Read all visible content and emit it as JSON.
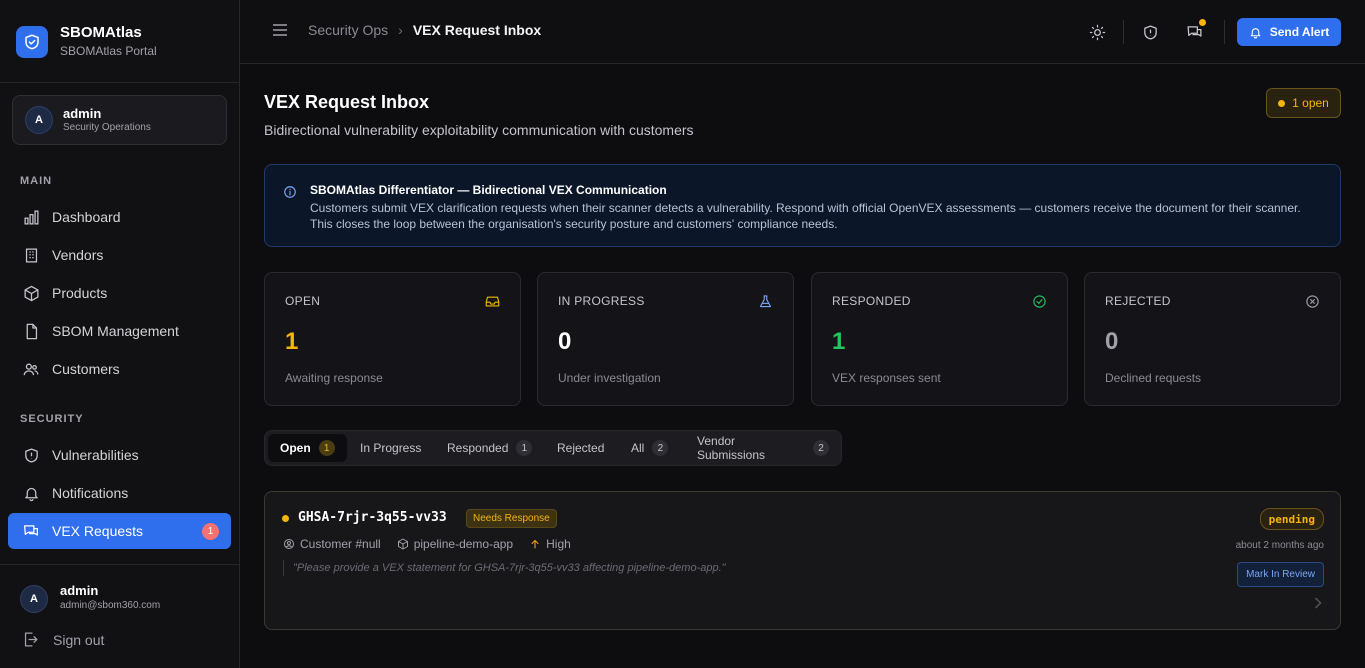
{
  "brand": {
    "title": "SBOMAtlas",
    "subtitle": "SBOMAtlas Portal"
  },
  "user_card": {
    "avatar": "A",
    "name": "admin",
    "role": "Security Operations"
  },
  "sidebar": {
    "main_label": "MAIN",
    "main_items": [
      {
        "label": "Dashboard",
        "icon": "chart-bars-icon"
      },
      {
        "label": "Vendors",
        "icon": "building-icon"
      },
      {
        "label": "Products",
        "icon": "cube-icon"
      },
      {
        "label": "SBOM Management",
        "icon": "document-icon"
      },
      {
        "label": "Customers",
        "icon": "users-icon"
      }
    ],
    "security_label": "SECURITY",
    "security_items": [
      {
        "label": "Vulnerabilities",
        "icon": "shield-alert-icon"
      },
      {
        "label": "Notifications",
        "icon": "bell-icon"
      },
      {
        "label": "VEX Requests",
        "icon": "chat-icon",
        "badge": "1",
        "active": true
      }
    ]
  },
  "bottom_user": {
    "avatar": "A",
    "name": "admin",
    "email": "admin@sbom360.com"
  },
  "signout": "Sign out",
  "header": {
    "breadcrumb_parent": "Security Ops",
    "breadcrumb_sep": "›",
    "breadcrumb_current": "VEX Request Inbox",
    "send_alert": "Send Alert"
  },
  "page": {
    "title": "VEX Request Inbox",
    "subtitle": "Bidirectional vulnerability exploitability communication with customers",
    "open_pill": "1 open"
  },
  "info": {
    "title": "SBOMAtlas Differentiator — Bidirectional VEX Communication",
    "body": "Customers submit VEX clarification requests when their scanner detects a vulnerability. Respond with official OpenVEX assessments — customers receive the document for their scanner. This closes the loop between the organisation's security posture and customers' compliance needs."
  },
  "stats": [
    {
      "label": "OPEN",
      "value": "1",
      "desc": "Awaiting response",
      "color": "#f5b50a",
      "icon": "inbox-icon"
    },
    {
      "label": "IN PROGRESS",
      "value": "0",
      "desc": "Under investigation",
      "color": "#ffffff",
      "icon": "flask-icon"
    },
    {
      "label": "RESPONDED",
      "value": "1",
      "desc": "VEX responses sent",
      "color": "#22c55e",
      "icon": "check-circle-icon"
    },
    {
      "label": "REJECTED",
      "value": "0",
      "desc": "Declined requests",
      "color": "#a1a1aa",
      "icon": "x-circle-icon"
    }
  ],
  "tabs": [
    {
      "label": "Open",
      "count": "1",
      "active": true
    },
    {
      "label": "In Progress",
      "count": null
    },
    {
      "label": "Responded",
      "count": "1"
    },
    {
      "label": "Rejected",
      "count": null
    },
    {
      "label": "All",
      "count": "2"
    },
    {
      "label": "Vendor Submissions",
      "count": "2"
    }
  ],
  "request": {
    "id": "GHSA-7rjr-3q55-vv33",
    "badge": "Needs Response",
    "customer": "Customer #null",
    "product": "pipeline-demo-app",
    "severity": "High",
    "quote": "\"Please provide a VEX statement for GHSA-7rjr-3q55-vv33 affecting pipeline-demo-app.\"",
    "status": "pending",
    "time": "about 2 months ago",
    "action": "Mark In Review"
  }
}
